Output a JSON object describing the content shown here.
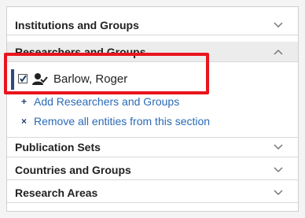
{
  "sections": [
    {
      "title": "Institutions and Groups",
      "expanded": false
    },
    {
      "title": "Researchers and Groups",
      "expanded": true
    },
    {
      "title": "Publication Sets",
      "expanded": false
    },
    {
      "title": "Countries and Groups",
      "expanded": false
    },
    {
      "title": "Research Areas",
      "expanded": false
    }
  ],
  "researchers": {
    "entity": {
      "name": "Barlow, Roger",
      "checked": true,
      "icon": "person-group-icon"
    },
    "add_link": "Add Researchers and Groups",
    "remove_link": "Remove all entities from this section"
  },
  "colors": {
    "accent": "#2e4a7d",
    "highlight": "#e8151c",
    "link": "#2a6ab5"
  }
}
